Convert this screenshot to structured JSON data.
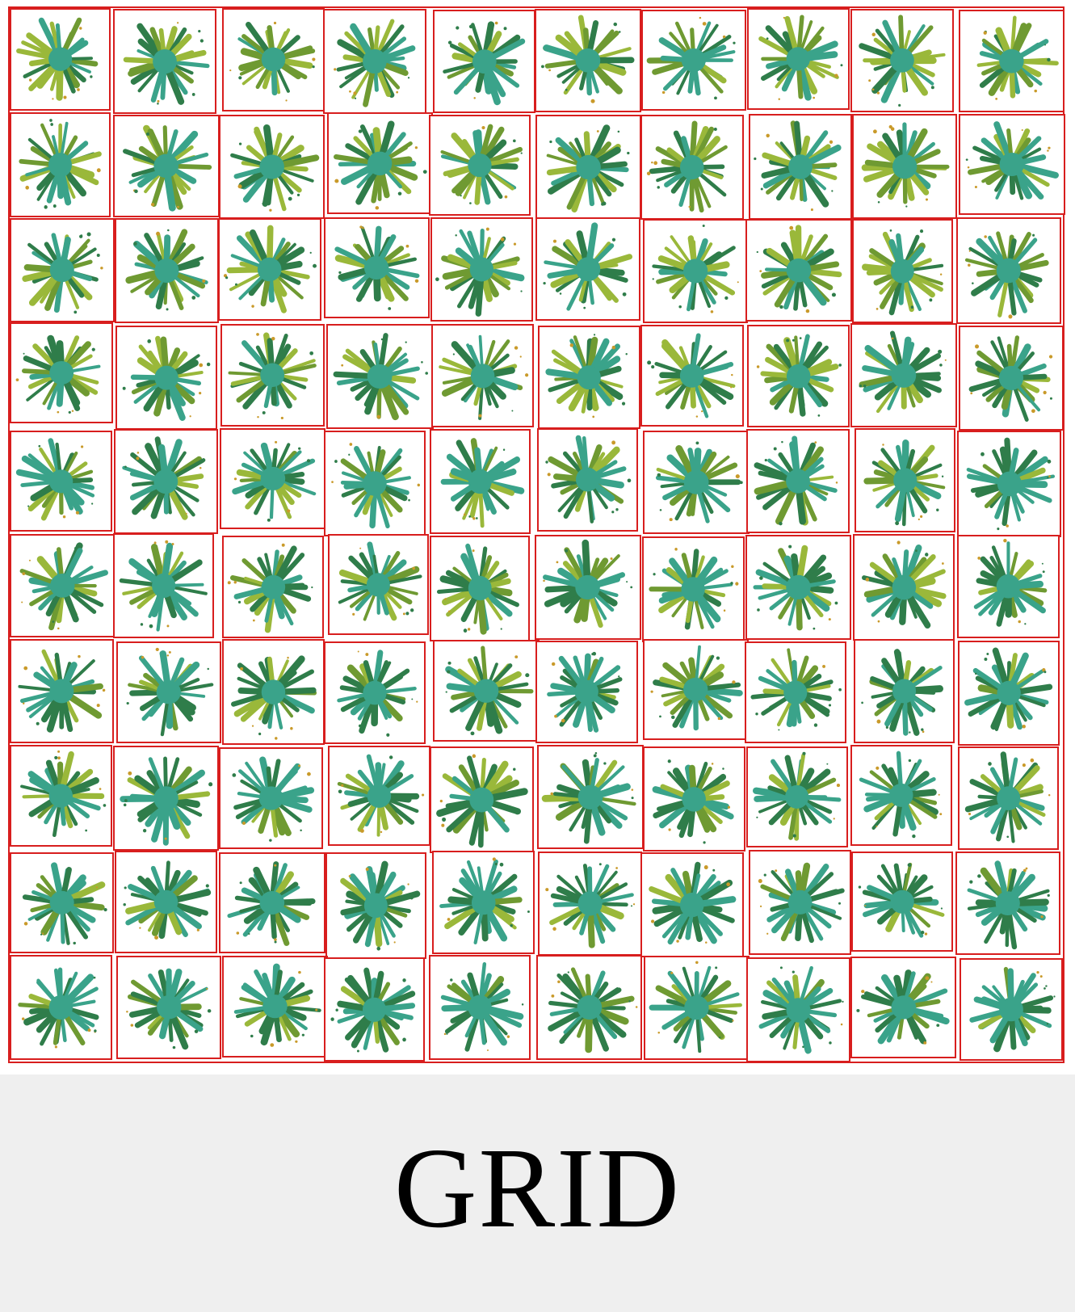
{
  "caption": "GRID",
  "grid": {
    "rows": 10,
    "columns": 10,
    "plant_count": 100
  },
  "colors": {
    "cell_border": "#d81e1e",
    "plant_dark_green": "#2f7d4a",
    "plant_teal": "#3aa38a",
    "plant_yellow_green": "#9ab83a",
    "plant_olive": "#6f9a32",
    "background": "#ffffff",
    "caption_band": "#efefef"
  }
}
